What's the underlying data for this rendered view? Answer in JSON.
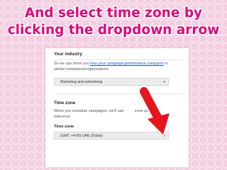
{
  "headline": {
    "line1": "And select time zone by",
    "line2": "clicking the dropdown arrow"
  },
  "industry": {
    "title": "Your industry",
    "text_before": "So we can show you ",
    "link": "how your campaign performance compares",
    "text_after": " to",
    "text_line2": "similar companies/organizations.",
    "select_value": "Marketing and advertising"
  },
  "timezone": {
    "title": "Time zone",
    "text_line1": "When you schedule campaigns, we'll use",
    "text_line1_tail": "zone as a",
    "text_line2": "reference.",
    "field_label": "Time zone",
    "select_value": "(GMT +4:00) UAE (Dubai)"
  },
  "icons": {
    "dropdown": "chevron-down-icon",
    "pointer": "red-arrow"
  },
  "colors": {
    "headline": "#e4007a",
    "arrow": "#e8141c",
    "link": "#1a57c8"
  }
}
